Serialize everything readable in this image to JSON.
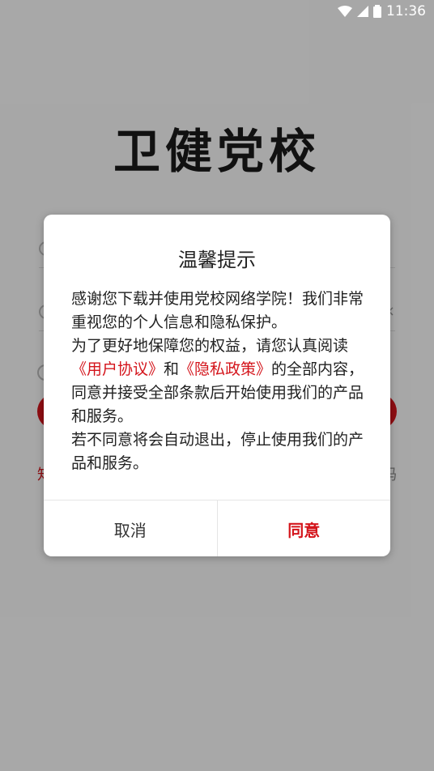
{
  "status_bar": {
    "time": "11:36",
    "wifi_icon": "wifi-icon",
    "signal_icon": "signal-icon",
    "battery_icon": "battery-icon"
  },
  "app": {
    "logo": "卫健党校",
    "forgot_link": "知",
    "right_link": "码"
  },
  "dialog": {
    "title": "温馨提示",
    "p1": "感谢您下载并使用党校网络学院！我们非常重视您的个人信息和隐私保护。",
    "p2_prefix": "为了更好地保障您的权益，请您认真阅读",
    "user_agreement": "《用户协议》",
    "and": "和",
    "privacy_policy": "《隐私政策》",
    "p2_suffix": "的全部内容，同意并接受全部条款后开始使用我们的产品和服务。",
    "p3": "若不同意将会自动退出，停止使用我们的产品和服务。",
    "cancel_label": "取消",
    "agree_label": "同意"
  },
  "colors": {
    "accent": "#d4141b",
    "overlay": "rgba(0,0,0,0.33)"
  }
}
